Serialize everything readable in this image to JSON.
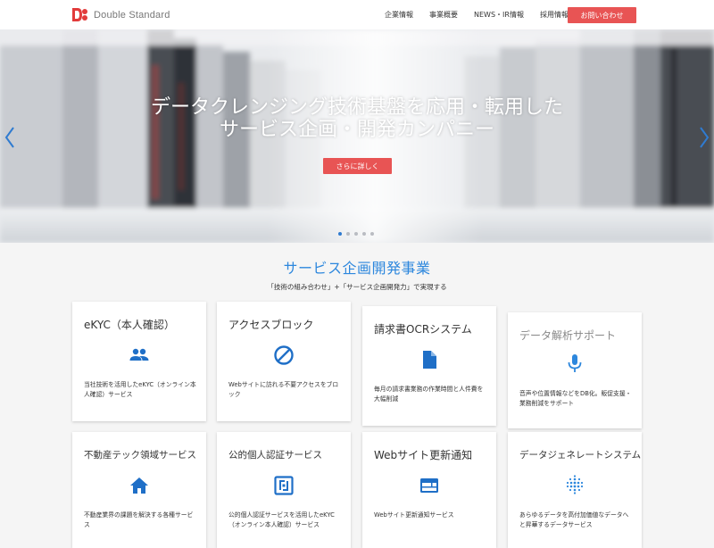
{
  "header": {
    "logo_text": "Double Standard",
    "nav": [
      "企業情報",
      "事業概要",
      "NEWS・IR情報",
      "採用情報"
    ],
    "contact_label": "お問い合わせ"
  },
  "hero": {
    "title_line1": "データクレンジング技術基盤を応用・転用した",
    "title_line2": "サービス企画・開発カンパニー",
    "button_label": "さらに詳しく",
    "slides_total": 5,
    "slide_active": 1
  },
  "section": {
    "title": "サービス企画開発事業",
    "subtitle": "「技術の組み合わせ」+「サービス企画開発力」で実現する"
  },
  "cards": [
    {
      "title": "eKYC（本人確認）",
      "icon": "people-icon",
      "desc": "当社技術を活用したeKYC（オンライン本人確認）サービス"
    },
    {
      "title": "アクセスブロック",
      "icon": "block-icon",
      "desc": "Webサイトに訪れる不要アクセスをブロック"
    },
    {
      "title": "請求書OCRシステム",
      "icon": "document-icon",
      "desc": "毎月の請求書業務の作業時間と人件費を大幅削減"
    },
    {
      "title": "データ解析サポート",
      "icon": "microphone-icon",
      "desc": "音声や位置情報などをDB化。販促支援・業務削減をサポート"
    },
    {
      "title": "不動産テック領域サービス",
      "icon": "home-icon",
      "desc": "不動産業界の課題を解決する各種サービス"
    },
    {
      "title": "公的個人認証サービス",
      "icon": "nfc-icon",
      "desc": "公的個人認証サービスを活用したeKYC（オンライン本人確認）サービス"
    },
    {
      "title": "Webサイト更新通知",
      "icon": "web-icon",
      "desc": "Webサイト更新通知サービス"
    },
    {
      "title": "データジェネレートシステム",
      "icon": "dots-grid-icon",
      "desc": "あらゆるデータを高付加価値なデータへと昇華するデータサービス"
    }
  ],
  "colors": {
    "accent_red": "#e85454",
    "accent_blue": "#2d87dd"
  }
}
